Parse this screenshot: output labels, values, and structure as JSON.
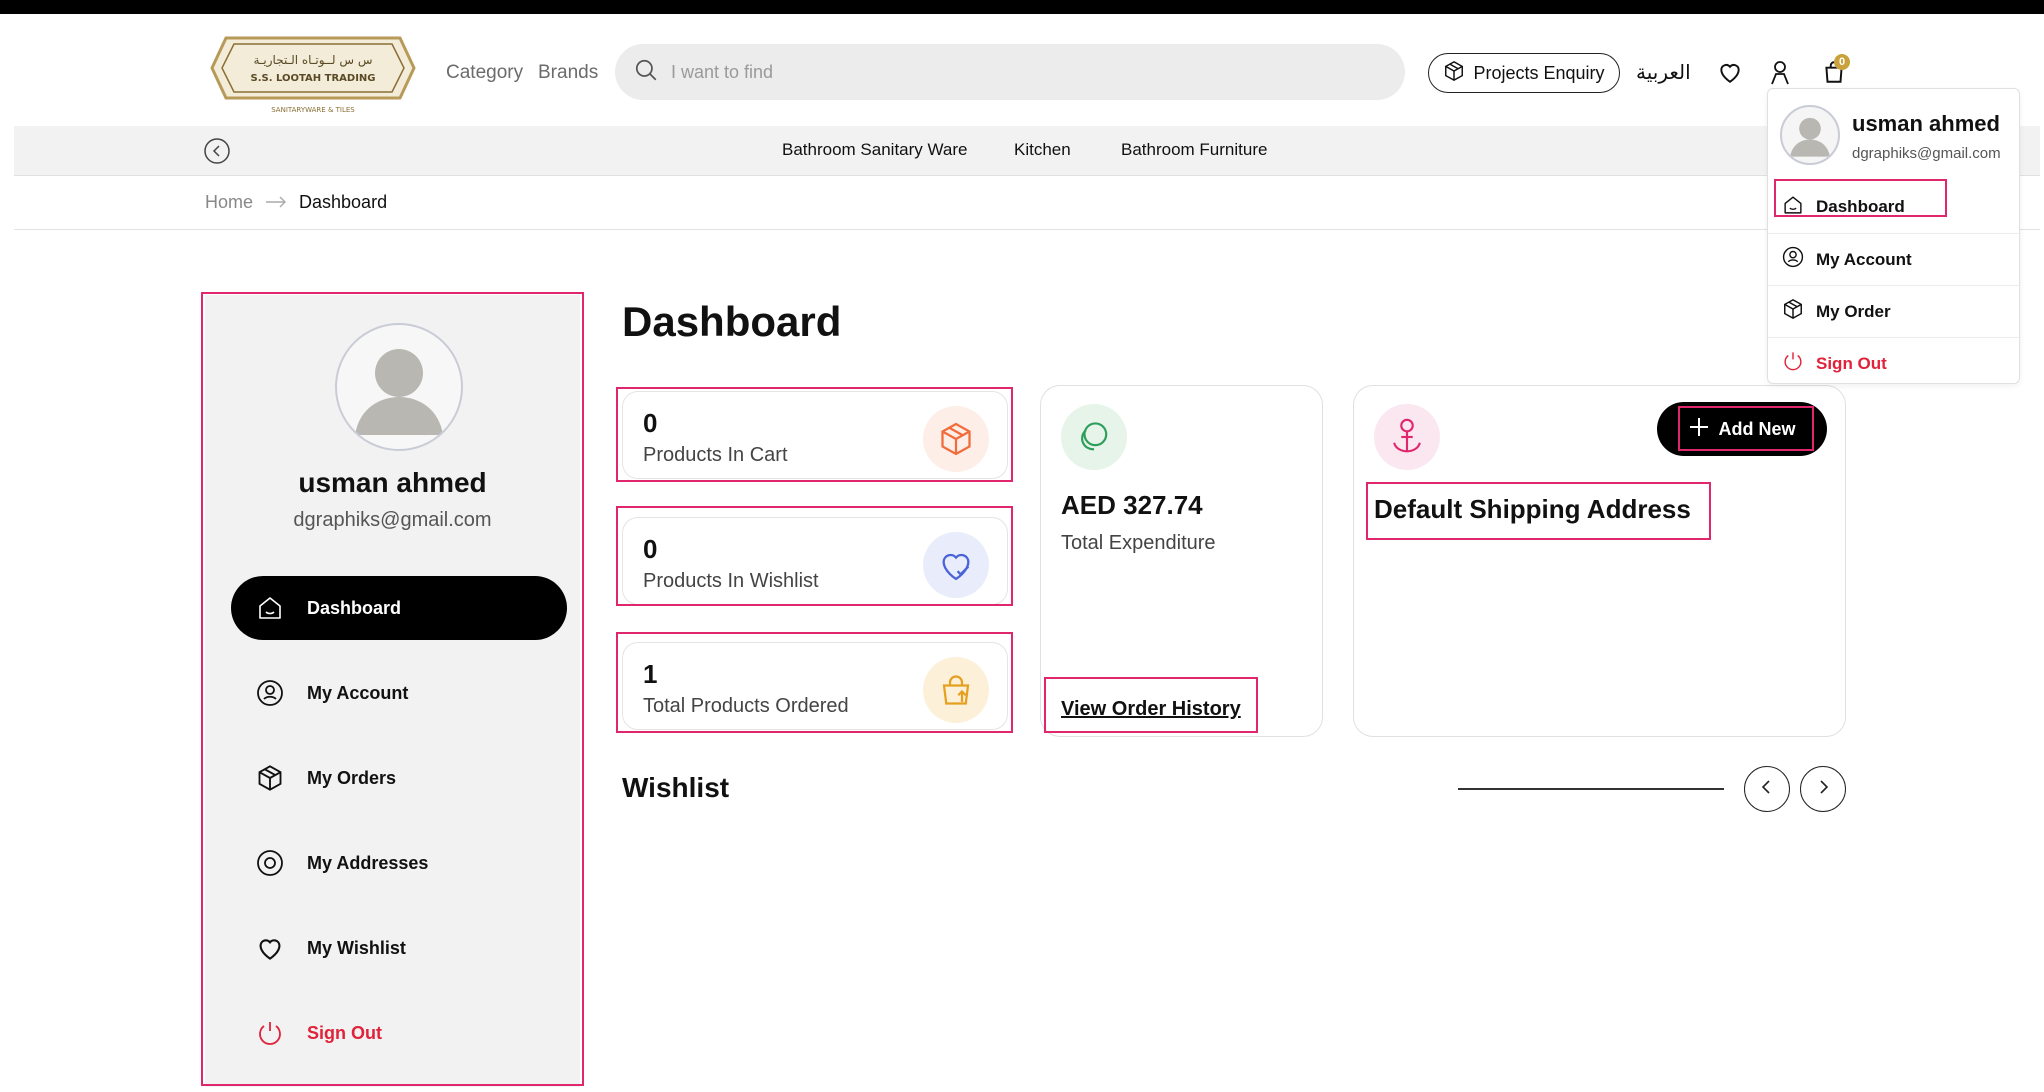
{
  "header": {
    "logo": {
      "arabic_name": "س س لــوتـاه الـتجاريـة",
      "english_name": "S.S. LOOTAH TRADING",
      "tagline": "SANITARYWARE & TILES"
    },
    "nav": {
      "category": "Category",
      "brands": "Brands"
    },
    "search": {
      "placeholder": "I want to find"
    },
    "projects_enquiry": "Projects Enquiry",
    "language": "العربية",
    "cart_count": "0"
  },
  "subnav": {
    "categories": [
      "Bathroom Sanitary Ware",
      "Kitchen",
      "Bathroom Furniture"
    ]
  },
  "breadcrumb": {
    "home": "Home",
    "current": "Dashboard"
  },
  "user": {
    "name": "usman ahmed",
    "email": "dgraphiks@gmail.com"
  },
  "sidebar": {
    "items": [
      {
        "label": "Dashboard",
        "icon": "home-icon"
      },
      {
        "label": "My Account",
        "icon": "user-circle-icon"
      },
      {
        "label": "My Orders",
        "icon": "box-icon"
      },
      {
        "label": "My Addresses",
        "icon": "location-icon"
      },
      {
        "label": "My Wishlist",
        "icon": "heart-icon"
      },
      {
        "label": "Sign Out",
        "icon": "power-icon"
      }
    ]
  },
  "main": {
    "title": "Dashboard",
    "stats": [
      {
        "value": "0",
        "label": "Products In Cart",
        "icon": "box-icon",
        "color": "#f26b3a"
      },
      {
        "value": "0",
        "label": "Products In Wishlist",
        "icon": "heart-check-icon",
        "color": "#4b63d8"
      },
      {
        "value": "1",
        "label": "Total Products Ordered",
        "icon": "bag-up-icon",
        "color": "#e5a020"
      }
    ],
    "expenditure": {
      "amount": "AED 327.74",
      "label": "Total Expenditure",
      "link": "View Order History"
    },
    "address": {
      "title": "Default Shipping Address",
      "add_new": "Add New"
    },
    "wishlist_title": "Wishlist"
  },
  "dropdown": {
    "items": [
      {
        "label": "Dashboard",
        "icon": "home-icon"
      },
      {
        "label": "My Account",
        "icon": "user-circle-icon"
      },
      {
        "label": "My Order",
        "icon": "box-icon"
      },
      {
        "label": "Sign Out",
        "icon": "power-icon"
      }
    ]
  },
  "colors": {
    "highlight": "#e0276e",
    "signout": "#e0223a",
    "gold": "#c9a23c"
  }
}
